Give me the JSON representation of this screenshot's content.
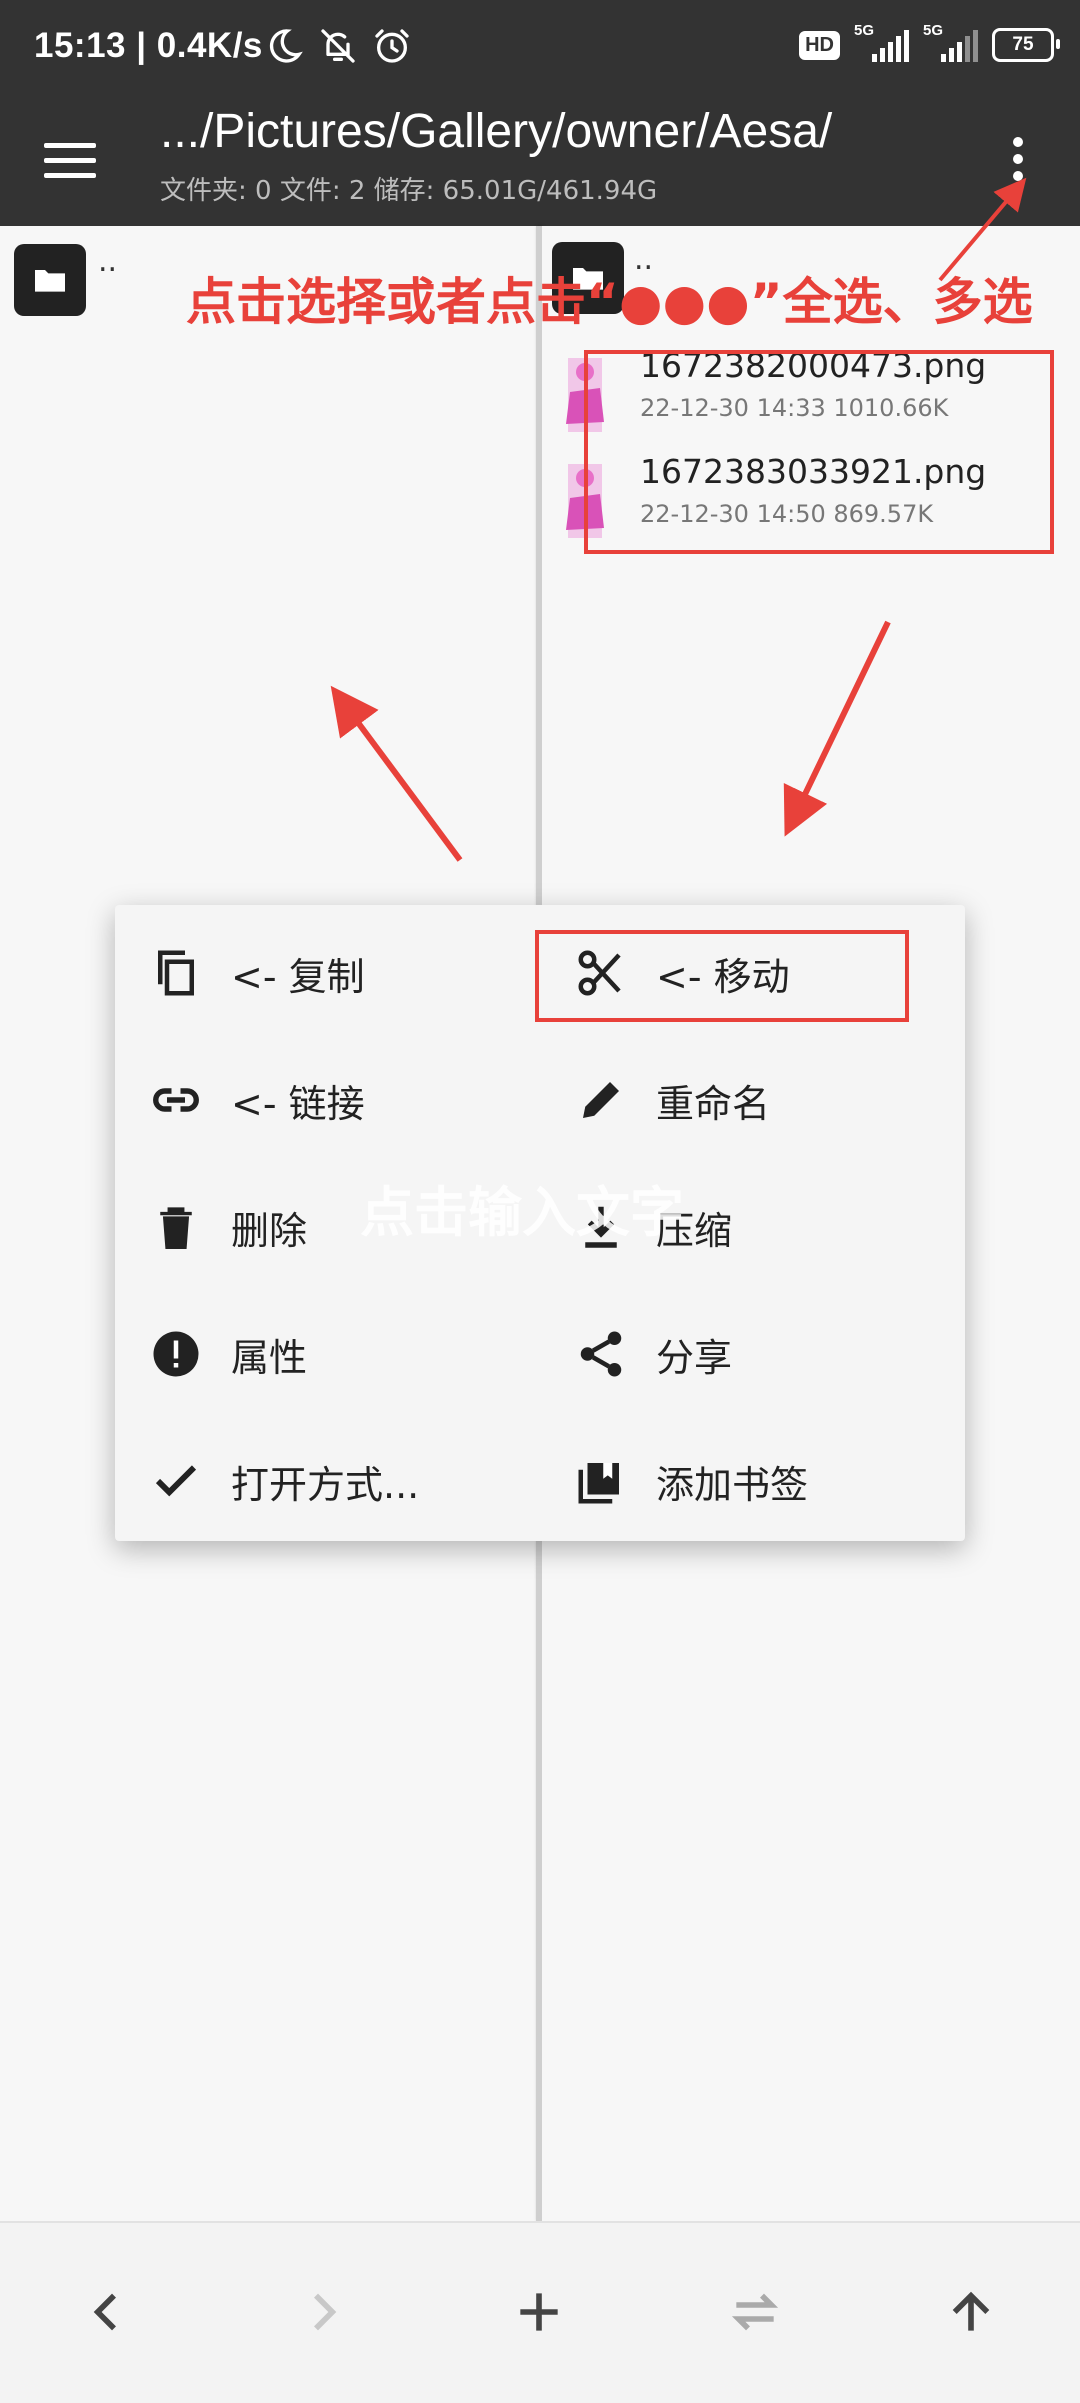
{
  "status_bar": {
    "time": "15:13 | 0.4K/s",
    "hd": "HD",
    "sim1_tag": "5G",
    "sim2_tag": "5G",
    "battery": "75",
    "icons": [
      "moon-icon",
      "bell-off-icon",
      "alarm-icon"
    ]
  },
  "app_bar": {
    "path": ".../Pictures/Gallery/owner/Aesa/",
    "summary": "文件夹: 0   文件: 2   储存: 65.01G/461.94G"
  },
  "left_pane": {
    "parent_label": ".."
  },
  "right_pane": {
    "parent_label": "..",
    "files": [
      {
        "name": "1672382000473.png",
        "meta": "22-12-30 14:33   1010.66K"
      },
      {
        "name": "1672383033921.png",
        "meta": "22-12-30 14:50   869.57K"
      }
    ]
  },
  "annotation": {
    "text": "点击选择或者点击“●●●”全选、多选",
    "color": "#e8413a"
  },
  "popup_menu": {
    "items": [
      {
        "label": "<- 复制",
        "icon": "copy-icon"
      },
      {
        "label": "<- 移动",
        "icon": "scissors-icon"
      },
      {
        "label": "<- 链接",
        "icon": "link-icon"
      },
      {
        "label": "重命名",
        "icon": "pencil-icon"
      },
      {
        "label": "删除",
        "icon": "trash-icon"
      },
      {
        "label": "压缩",
        "icon": "download-icon"
      },
      {
        "label": "属性",
        "icon": "info-icon"
      },
      {
        "label": "分享",
        "icon": "share-icon"
      },
      {
        "label": "打开方式...",
        "icon": "check-icon"
      },
      {
        "label": "添加书签",
        "icon": "bookmark-icon"
      }
    ],
    "watermark": "点击输入文字"
  },
  "bottom_bar": {
    "buttons": [
      "back-icon",
      "forward-icon",
      "add-icon",
      "swap-icon",
      "up-icon"
    ]
  }
}
